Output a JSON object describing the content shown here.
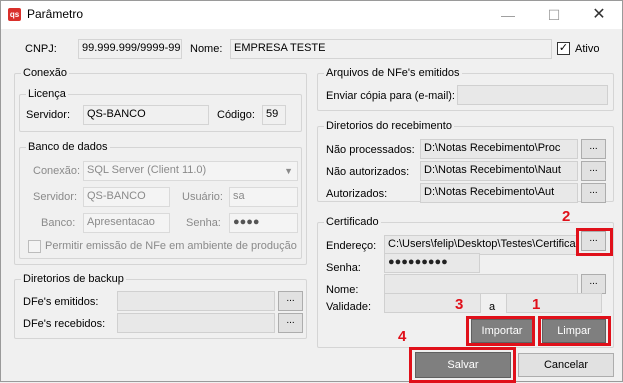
{
  "window": {
    "title": "Parâmetro",
    "app_icon": "qs",
    "minimize": "—",
    "maximize": "☐",
    "close": "✕"
  },
  "top": {
    "cnpj_label": "CNPJ:",
    "cnpj_value": "99.999.999/9999-99",
    "nome_label": "Nome:",
    "nome_value": "EMPRESA TESTE",
    "ativo_label": "Ativo",
    "ativo_checked": "✓"
  },
  "conexao": {
    "title": "Conexão",
    "licenca": {
      "title": "Licença",
      "servidor_label": "Servidor:",
      "servidor_value": "QS-BANCO",
      "codigo_label": "Código:",
      "codigo_value": "59"
    },
    "banco": {
      "title": "Banco de dados",
      "conexao_label": "Conexão:",
      "conexao_value": "SQL Server (Client 11.0)",
      "servidor_label": "Servidor:",
      "servidor_value": "QS-BANCO",
      "usuario_label": "Usuário:",
      "usuario_value": "sa",
      "banco_label": "Banco:",
      "banco_value": "Apresentacao",
      "senha_label": "Senha:",
      "senha_value": "●●●●",
      "producao_label": "Permitir emissão de NFe em ambiente de produção"
    }
  },
  "backup": {
    "title": "Diretorios de backup",
    "emitidos_label": "DFe's emitidos:",
    "recebidos_label": "DFe's recebidos:",
    "browse": "..."
  },
  "arquivos": {
    "title": "Arquivos de NFe's emitidos",
    "email_label": "Enviar cópia para (e-mail):"
  },
  "recebimento": {
    "title": "Diretorios do recebimento",
    "processados_label": "Não processados:",
    "processados_value": "D:\\Notas Recebimento\\Proc",
    "autorizados_nao_label": "Não autorizados:",
    "autorizados_nao_value": "D:\\Notas Recebimento\\Naut",
    "autorizados_label": "Autorizados:",
    "autorizados_value": "D:\\Notas Recebimento\\Aut",
    "browse": "..."
  },
  "certificado": {
    "title": "Certificado",
    "endereco_label": "Endereço:",
    "endereco_value": "C:\\Users\\felip\\Desktop\\Testes\\Certificado",
    "senha_label": "Senha:",
    "senha_value": "●●●●●●●●●",
    "nome_label": "Nome:",
    "validade_label": "Validade:",
    "a_label": "a",
    "browse": "...",
    "importar": "Importar",
    "limpar": "Limpar"
  },
  "footer": {
    "salvar": "Salvar",
    "cancelar": "Cancelar"
  },
  "annotations": {
    "n1": "1",
    "n2": "2",
    "n3": "3",
    "n4": "4",
    "color": "#e0101a"
  }
}
